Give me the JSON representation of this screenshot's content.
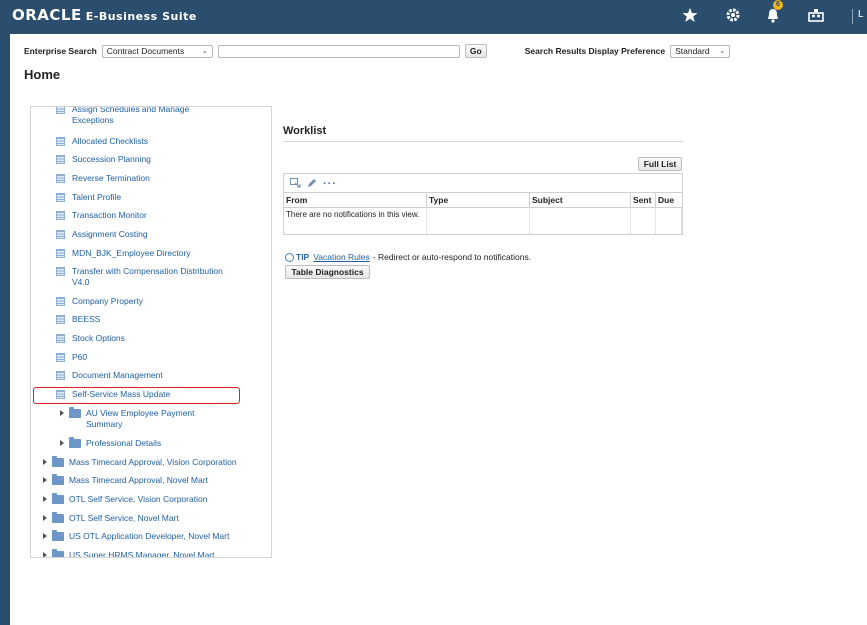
{
  "header": {
    "brand": "ORACLE",
    "suite": "E-Business Suite",
    "bell_count": "6",
    "user_initial": "L"
  },
  "search": {
    "label": "Enterprise Search",
    "category": "Contract Documents",
    "query": "",
    "go_label": "Go",
    "pref_label": "Search Results Display Preference",
    "pref_value": "Standard"
  },
  "page": {
    "title": "Home"
  },
  "navigator": {
    "items": [
      {
        "label": "Assign Schedules and Manage Exceptions",
        "kind": "page"
      },
      {
        "label": "Allocated Checklists",
        "kind": "page"
      },
      {
        "label": "Succession Planning",
        "kind": "page"
      },
      {
        "label": "Reverse Termination",
        "kind": "page"
      },
      {
        "label": "Talent Profile",
        "kind": "page"
      },
      {
        "label": "Transaction Monitor",
        "kind": "page"
      },
      {
        "label": "Assignment Costing",
        "kind": "page"
      },
      {
        "label": "MDN_BJK_Employee Directory",
        "kind": "page"
      },
      {
        "label": "Transfer with Compensation Distribution V4.0",
        "kind": "page"
      },
      {
        "label": "Company Property",
        "kind": "page"
      },
      {
        "label": "BEESS",
        "kind": "page"
      },
      {
        "label": "Stock Options",
        "kind": "page"
      },
      {
        "label": "P60",
        "kind": "page"
      },
      {
        "label": "Document Management",
        "kind": "page"
      },
      {
        "label": "Self-Service Mass Update",
        "kind": "page",
        "highlighted": true
      },
      {
        "label": "AU View Employee Payment Summary",
        "kind": "folder"
      },
      {
        "label": "Professional Details",
        "kind": "folder"
      },
      {
        "label": "Mass Timecard Approval, Vision Corporation",
        "kind": "folder"
      },
      {
        "label": "Mass Timecard Approval, Novel Mart",
        "kind": "folder"
      },
      {
        "label": "OTL Self Service, Vision Corporation",
        "kind": "folder"
      },
      {
        "label": "OTL Self Service, Novel Mart",
        "kind": "folder"
      },
      {
        "label": "US OTL Application Developer, Novel Mart",
        "kind": "folder"
      },
      {
        "label": "US Super HRMS Manager, Novel Mart",
        "kind": "folder"
      }
    ]
  },
  "worklist": {
    "title": "Worklist",
    "full_list_label": "Full List",
    "columns": [
      "From",
      "Type",
      "Subject",
      "Sent",
      "Due"
    ],
    "empty_message": "There are no notifications in this view.",
    "tip_label": "TIP",
    "tip_link": "Vacation Rules",
    "tip_text": "- Redirect or auto-respond to notifications.",
    "diagnostics_label": "Table Diagnostics"
  }
}
